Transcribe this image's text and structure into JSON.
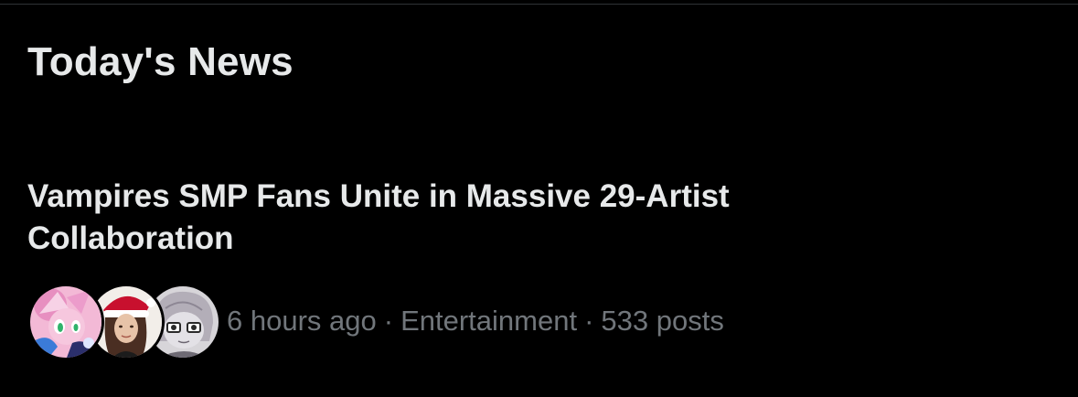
{
  "section": {
    "title": "Today's News"
  },
  "news_item": {
    "headline": "Vampires SMP Fans Unite in Massive 29-Artist Collaboration",
    "time": "6 hours ago",
    "category": "Entertainment",
    "posts": "533 posts",
    "separator": "·",
    "avatars": [
      "avatar-pink-character",
      "avatar-santa-hat-person",
      "avatar-grey-character"
    ]
  },
  "colors": {
    "background": "#000000",
    "primary_text": "#e7e9ea",
    "secondary_text": "#71767b",
    "divider": "#2f3336"
  }
}
